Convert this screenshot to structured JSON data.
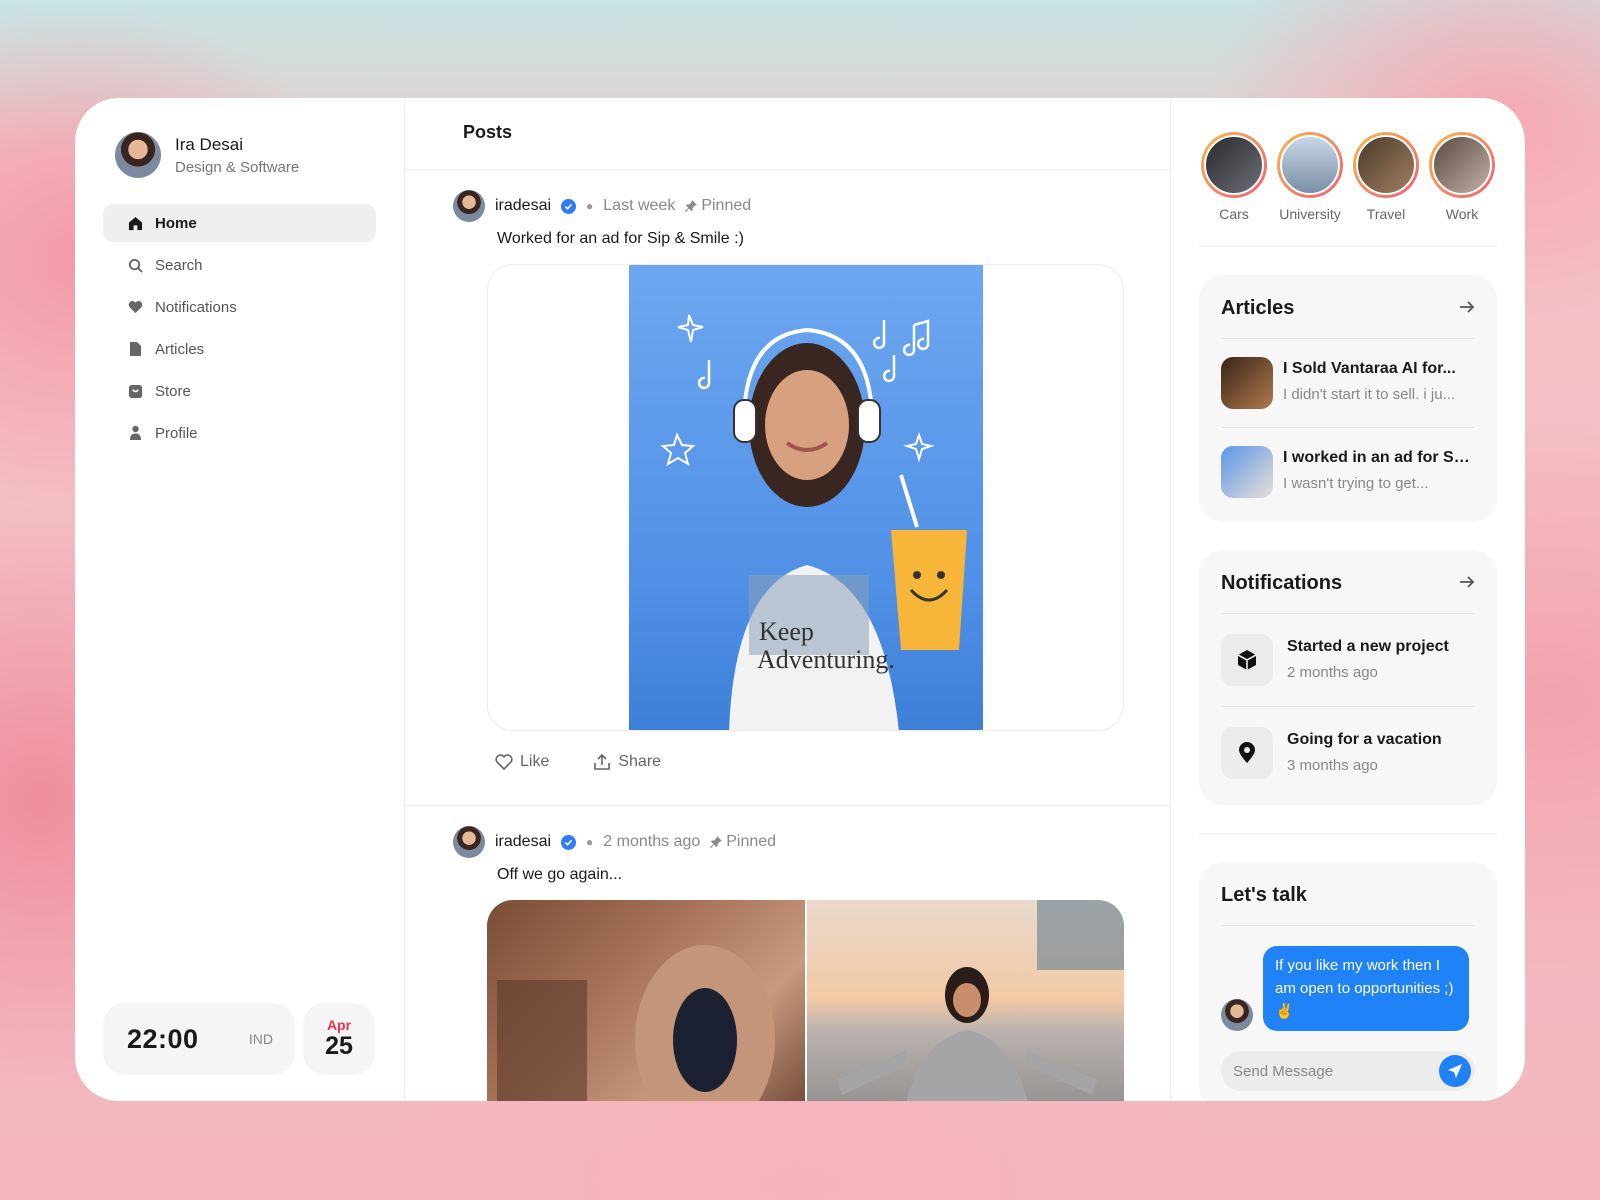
{
  "profile": {
    "name": "Ira Desai",
    "role": "Design & Software"
  },
  "nav": [
    {
      "label": "Home",
      "icon": "home-icon"
    },
    {
      "label": "Search",
      "icon": "search-icon"
    },
    {
      "label": "Notifications",
      "icon": "heart-icon"
    },
    {
      "label": "Articles",
      "icon": "document-icon"
    },
    {
      "label": "Store",
      "icon": "store-icon"
    },
    {
      "label": "Profile",
      "icon": "user-icon"
    }
  ],
  "clock": {
    "time": "22:00",
    "zone": "IND"
  },
  "date": {
    "month": "Apr",
    "day": "25"
  },
  "main": {
    "title": "Posts"
  },
  "posts": [
    {
      "user": "iradesai",
      "time": "Last week",
      "pinned": "Pinned",
      "text": "Worked for an ad for Sip & Smile :)",
      "like": "Like",
      "share": "Share"
    },
    {
      "user": "iradesai",
      "time": "2 months ago",
      "pinned": "Pinned",
      "text": "Off we go again..."
    }
  ],
  "stories": [
    {
      "label": "Cars"
    },
    {
      "label": "University"
    },
    {
      "label": "Travel"
    },
    {
      "label": "Work"
    }
  ],
  "articles": {
    "title": "Articles",
    "items": [
      {
        "title": "I Sold Vantaraa AI for...",
        "sub": "I didn't start it to sell. i ju..."
      },
      {
        "title": "I worked in an ad for Si...",
        "sub": "I wasn't trying to get..."
      }
    ]
  },
  "notifications": {
    "title": "Notifications",
    "items": [
      {
        "title": "Started a new project",
        "sub": "2 months ago",
        "icon": "cube-icon"
      },
      {
        "title": "Going for a vacation",
        "sub": "3 months ago",
        "icon": "location-pin-icon"
      }
    ]
  },
  "talk": {
    "title": "Let's talk",
    "message": "If you like my work then I am open to opportunities ;)✌️",
    "placeholder": "Send Message"
  },
  "colors": {
    "accent": "#1f82f7",
    "date_month": "#e8354f"
  }
}
